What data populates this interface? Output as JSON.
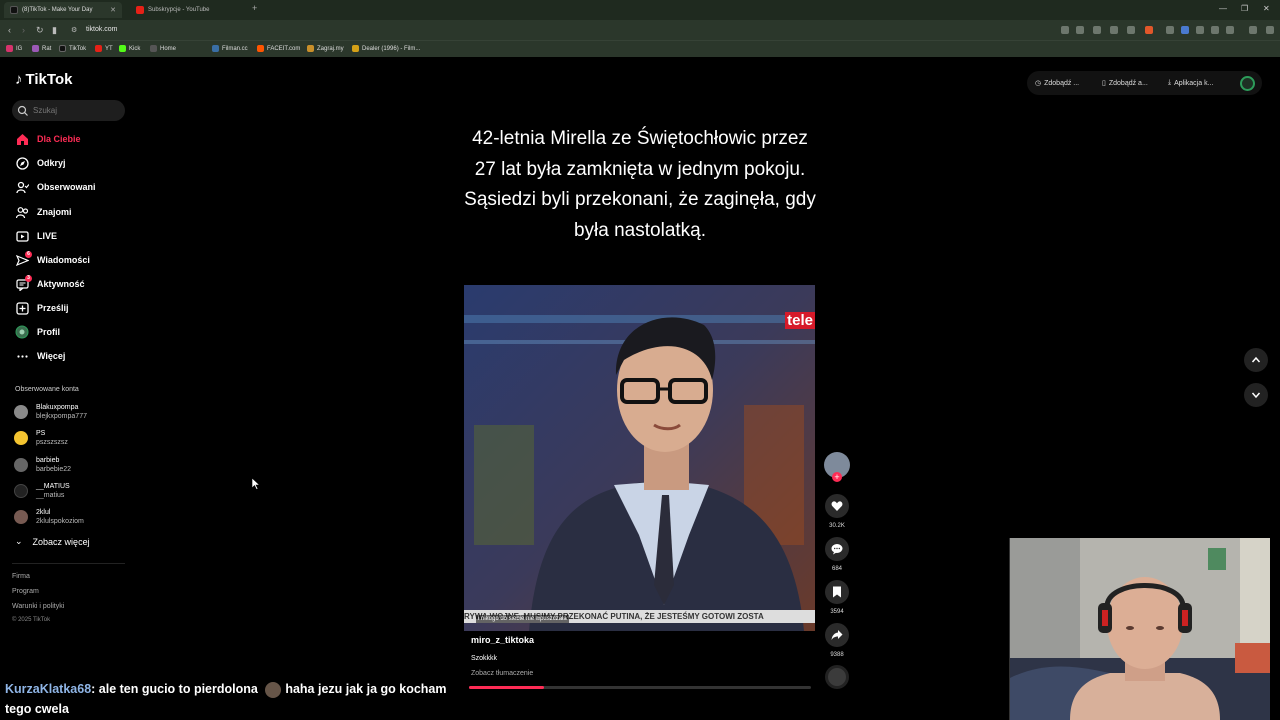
{
  "browser": {
    "tabs": [
      {
        "label": "(8)TikTok - Make Your Day",
        "active": true
      },
      {
        "label": "Subskrypcje - YouTube",
        "active": false
      }
    ],
    "url": "tiktok.com",
    "bookmarks": [
      "IG",
      "Rat",
      "TikTok",
      "YT",
      "Kick",
      "Home",
      "Filman.cc",
      "FACEIT.com",
      "Zagraj.my",
      "Dealer (1996) - Film..."
    ]
  },
  "sidebar": {
    "logo": "TikTok",
    "search_placeholder": "Szukaj",
    "nav": [
      {
        "label": "Dla Ciebie",
        "icon": "home-icon",
        "active": true
      },
      {
        "label": "Odkryj",
        "icon": "compass-icon"
      },
      {
        "label": "Obserwowani",
        "icon": "following-icon"
      },
      {
        "label": "Znajomi",
        "icon": "friends-icon"
      },
      {
        "label": "LIVE",
        "icon": "live-icon"
      },
      {
        "label": "Wiadomości",
        "icon": "messages-icon",
        "badge": "6"
      },
      {
        "label": "Aktywność",
        "icon": "activity-icon",
        "badge": "3"
      },
      {
        "label": "Prześlij",
        "icon": "upload-icon"
      },
      {
        "label": "Profil",
        "icon": "profile-icon"
      },
      {
        "label": "Więcej",
        "icon": "more-icon"
      }
    ],
    "followed_header": "Obserwowane konta",
    "followed": [
      {
        "name": "Blakuxpompa",
        "handle": "blejkxpompa777"
      },
      {
        "name": "PS",
        "handle": "pszszszsz"
      },
      {
        "name": "barbieb",
        "handle": "barbebie22"
      },
      {
        "name": "__MATIUS",
        "handle": "__matius"
      },
      {
        "name": "2klul",
        "handle": "2klulspokoziom"
      }
    ],
    "see_more": "Zobacz więcej",
    "footer": [
      "Firma",
      "Program",
      "Warunki i polityki"
    ],
    "copyright": "© 2025 TikTok"
  },
  "top_actions": [
    "Zdobądź ...",
    "Zdobądź a...",
    "Aplikacja k..."
  ],
  "video": {
    "headline": "42-letnia Mirella ze Świętochłowic przez 27 lat była zamknięta w jednym pokoju. Sąsiedzi byli przekonani, że zaginęła, gdy była nastolatką.",
    "channel_logo": "tele",
    "ticker": "RYWA WOJNE. MUSIMY PRZEKONAĆ PUTINA, ŻE JESTEŚMY GOTOWI ZOSTA",
    "caption": "i nikogo do siebie nie wpuszczała",
    "author": "miro_z_tiktoka",
    "description": "Szokkkk",
    "translate": "Zobacz tłumaczenie",
    "progress": 0.22
  },
  "actions": {
    "likes": "30.2K",
    "comments": "684",
    "saves": "3594",
    "shares": "9388"
  },
  "chat": {
    "user": "KurzaKlatka68",
    "message1": ": ale ten gucio to pierdolona",
    "message2": "haha jezu jak ja go kocham",
    "message3": "tego cwela"
  },
  "colors": {
    "accent": "#fe2c55",
    "chat_user": "#8fb5e6"
  }
}
